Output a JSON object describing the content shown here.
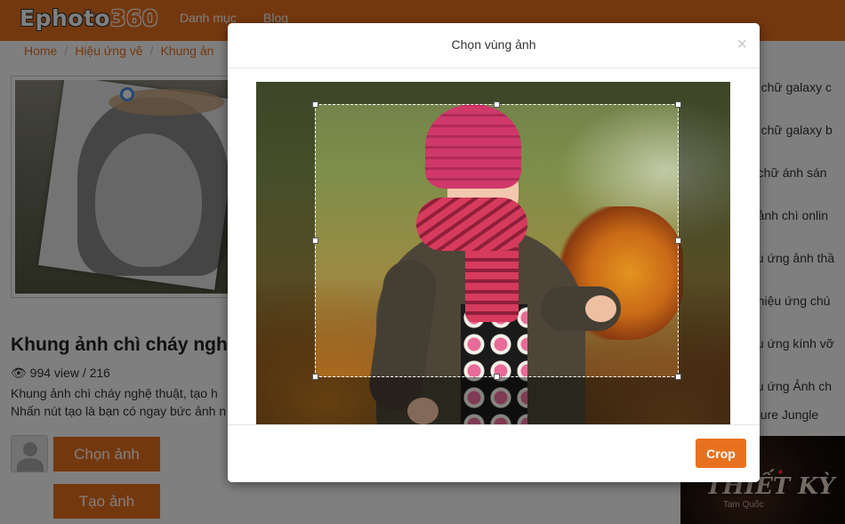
{
  "header": {
    "logo_part1": "Ephoto",
    "logo_part2": "360",
    "nav": [
      "Danh mục",
      "Blog"
    ]
  },
  "breadcrumb": [
    "Home",
    "Hiệu ứng vẽ",
    "Khung ản"
  ],
  "main": {
    "title": "Khung ảnh chì cháy ngh",
    "views": "994 view / 216",
    "description": [
      "Khung ảnh chì cháy nghệ thuật, tạo h",
      "Nhấn nút tạo là bạn có ngay bức ảnh n"
    ],
    "choose_photo_label": "Chọn ảnh",
    "create_photo_label": "Tạo ảnh"
  },
  "sidebar": {
    "items": [
      "ết chữ galaxy c",
      "ết chữ galaxy b",
      "o chữ ánh sán",
      "o ảnh chì onlin",
      "iệu ứng ảnh thầ",
      "o hiệu ứng chú",
      "iệu ứng kính vỡ",
      "iệu ứng Ảnh ch",
      "osure Jungle"
    ],
    "ad_title": "THIẾT KỲ",
    "ad_subtitle": "Tam Quốc"
  },
  "modal": {
    "title": "Chọn vùng ảnh",
    "close": "×",
    "crop_label": "Crop"
  },
  "colors": {
    "brand": "#e8711f",
    "crop_border": "#ffffff"
  }
}
